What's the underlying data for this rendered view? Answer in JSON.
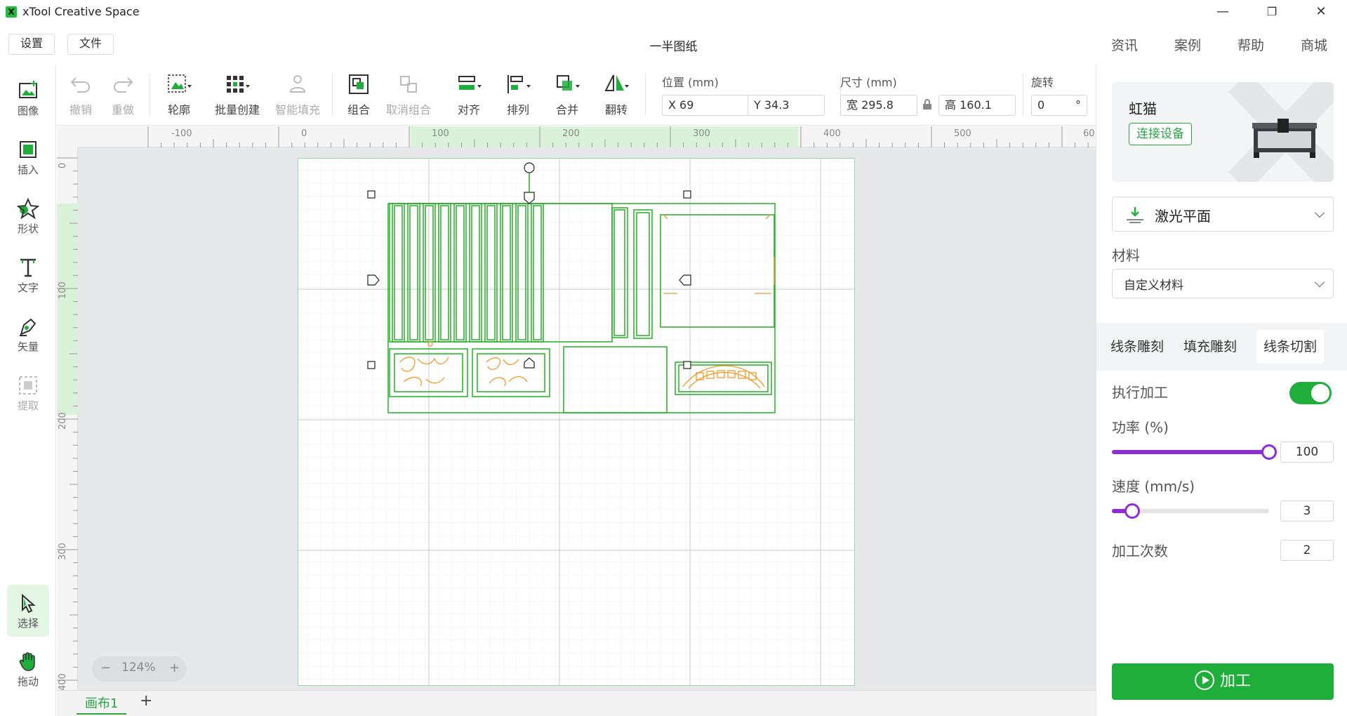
{
  "app": {
    "title": "xTool Creative Space",
    "logo_text": "X"
  },
  "window_controls": {
    "minimize": "—",
    "maximize": "❐",
    "close": "✕"
  },
  "menu": {
    "settings": "设置",
    "file": "文件"
  },
  "document": {
    "title": "一半图纸"
  },
  "top_links": [
    "资讯",
    "案例",
    "帮助",
    "商城"
  ],
  "left_tools": [
    {
      "label": "图像",
      "icon": "image-icon"
    },
    {
      "label": "插入",
      "icon": "insert-icon"
    },
    {
      "label": "形状",
      "icon": "shape-icon"
    },
    {
      "label": "文字",
      "icon": "text-icon"
    },
    {
      "label": "矢量",
      "icon": "vector-pen-icon"
    },
    {
      "label": "提取",
      "icon": "extract-icon"
    },
    {
      "label": "选择",
      "icon": "select-cursor-icon"
    },
    {
      "label": "拖动",
      "icon": "hand-drag-icon"
    }
  ],
  "toolbar": {
    "undo": "撤销",
    "redo": "重做",
    "outline": "轮廓",
    "batch_create": "批量创建",
    "smart_fill": "智能填充",
    "group": "组合",
    "ungroup": "取消组合",
    "align": "对齐",
    "arrange": "排列",
    "combine": "合并",
    "flip": "翻转",
    "position_label": "位置 (mm)",
    "x_value": "X 69",
    "y_value": "Y 34.3",
    "size_label": "尺寸 (mm)",
    "width_value": "宽 295.8",
    "height_value": "高 160.1",
    "rotate_label": "旋转",
    "rotate_value": "0",
    "rotate_unit": "°"
  },
  "rulers": {
    "h_ticks": [
      "-100",
      "0",
      "100",
      "200",
      "300",
      "400",
      "500",
      "60"
    ],
    "v_ticks": [
      "0",
      "100",
      "200",
      "300",
      "400"
    ]
  },
  "canvas": {
    "zoom": "124%",
    "zoom_minus": "−",
    "zoom_plus": "+",
    "tab_label": "画布1",
    "add_tab": "+"
  },
  "panel": {
    "device_name": "虹猫",
    "connect_label": "连接设备",
    "mode": "激光平面",
    "material_label": "材料",
    "material_value": "自定义材料",
    "process_tabs": [
      "线条雕刻",
      "填充雕刻",
      "线条切割"
    ],
    "active_process_tab": 2,
    "execute_label": "执行加工",
    "execute_on": true,
    "power_label": "功率 (%)",
    "power_value": "100",
    "power_fraction": 1.0,
    "speed_label": "速度 (mm/s)",
    "speed_value": "3",
    "speed_fraction": 0.13,
    "passes_label": "加工次数",
    "passes_value": "2",
    "start_label": "加工"
  },
  "colors": {
    "accent": "#1fae3a",
    "slider": "#8d2bd9",
    "design_stroke": "#22b022",
    "engrave_orange": "#f09a2a"
  }
}
